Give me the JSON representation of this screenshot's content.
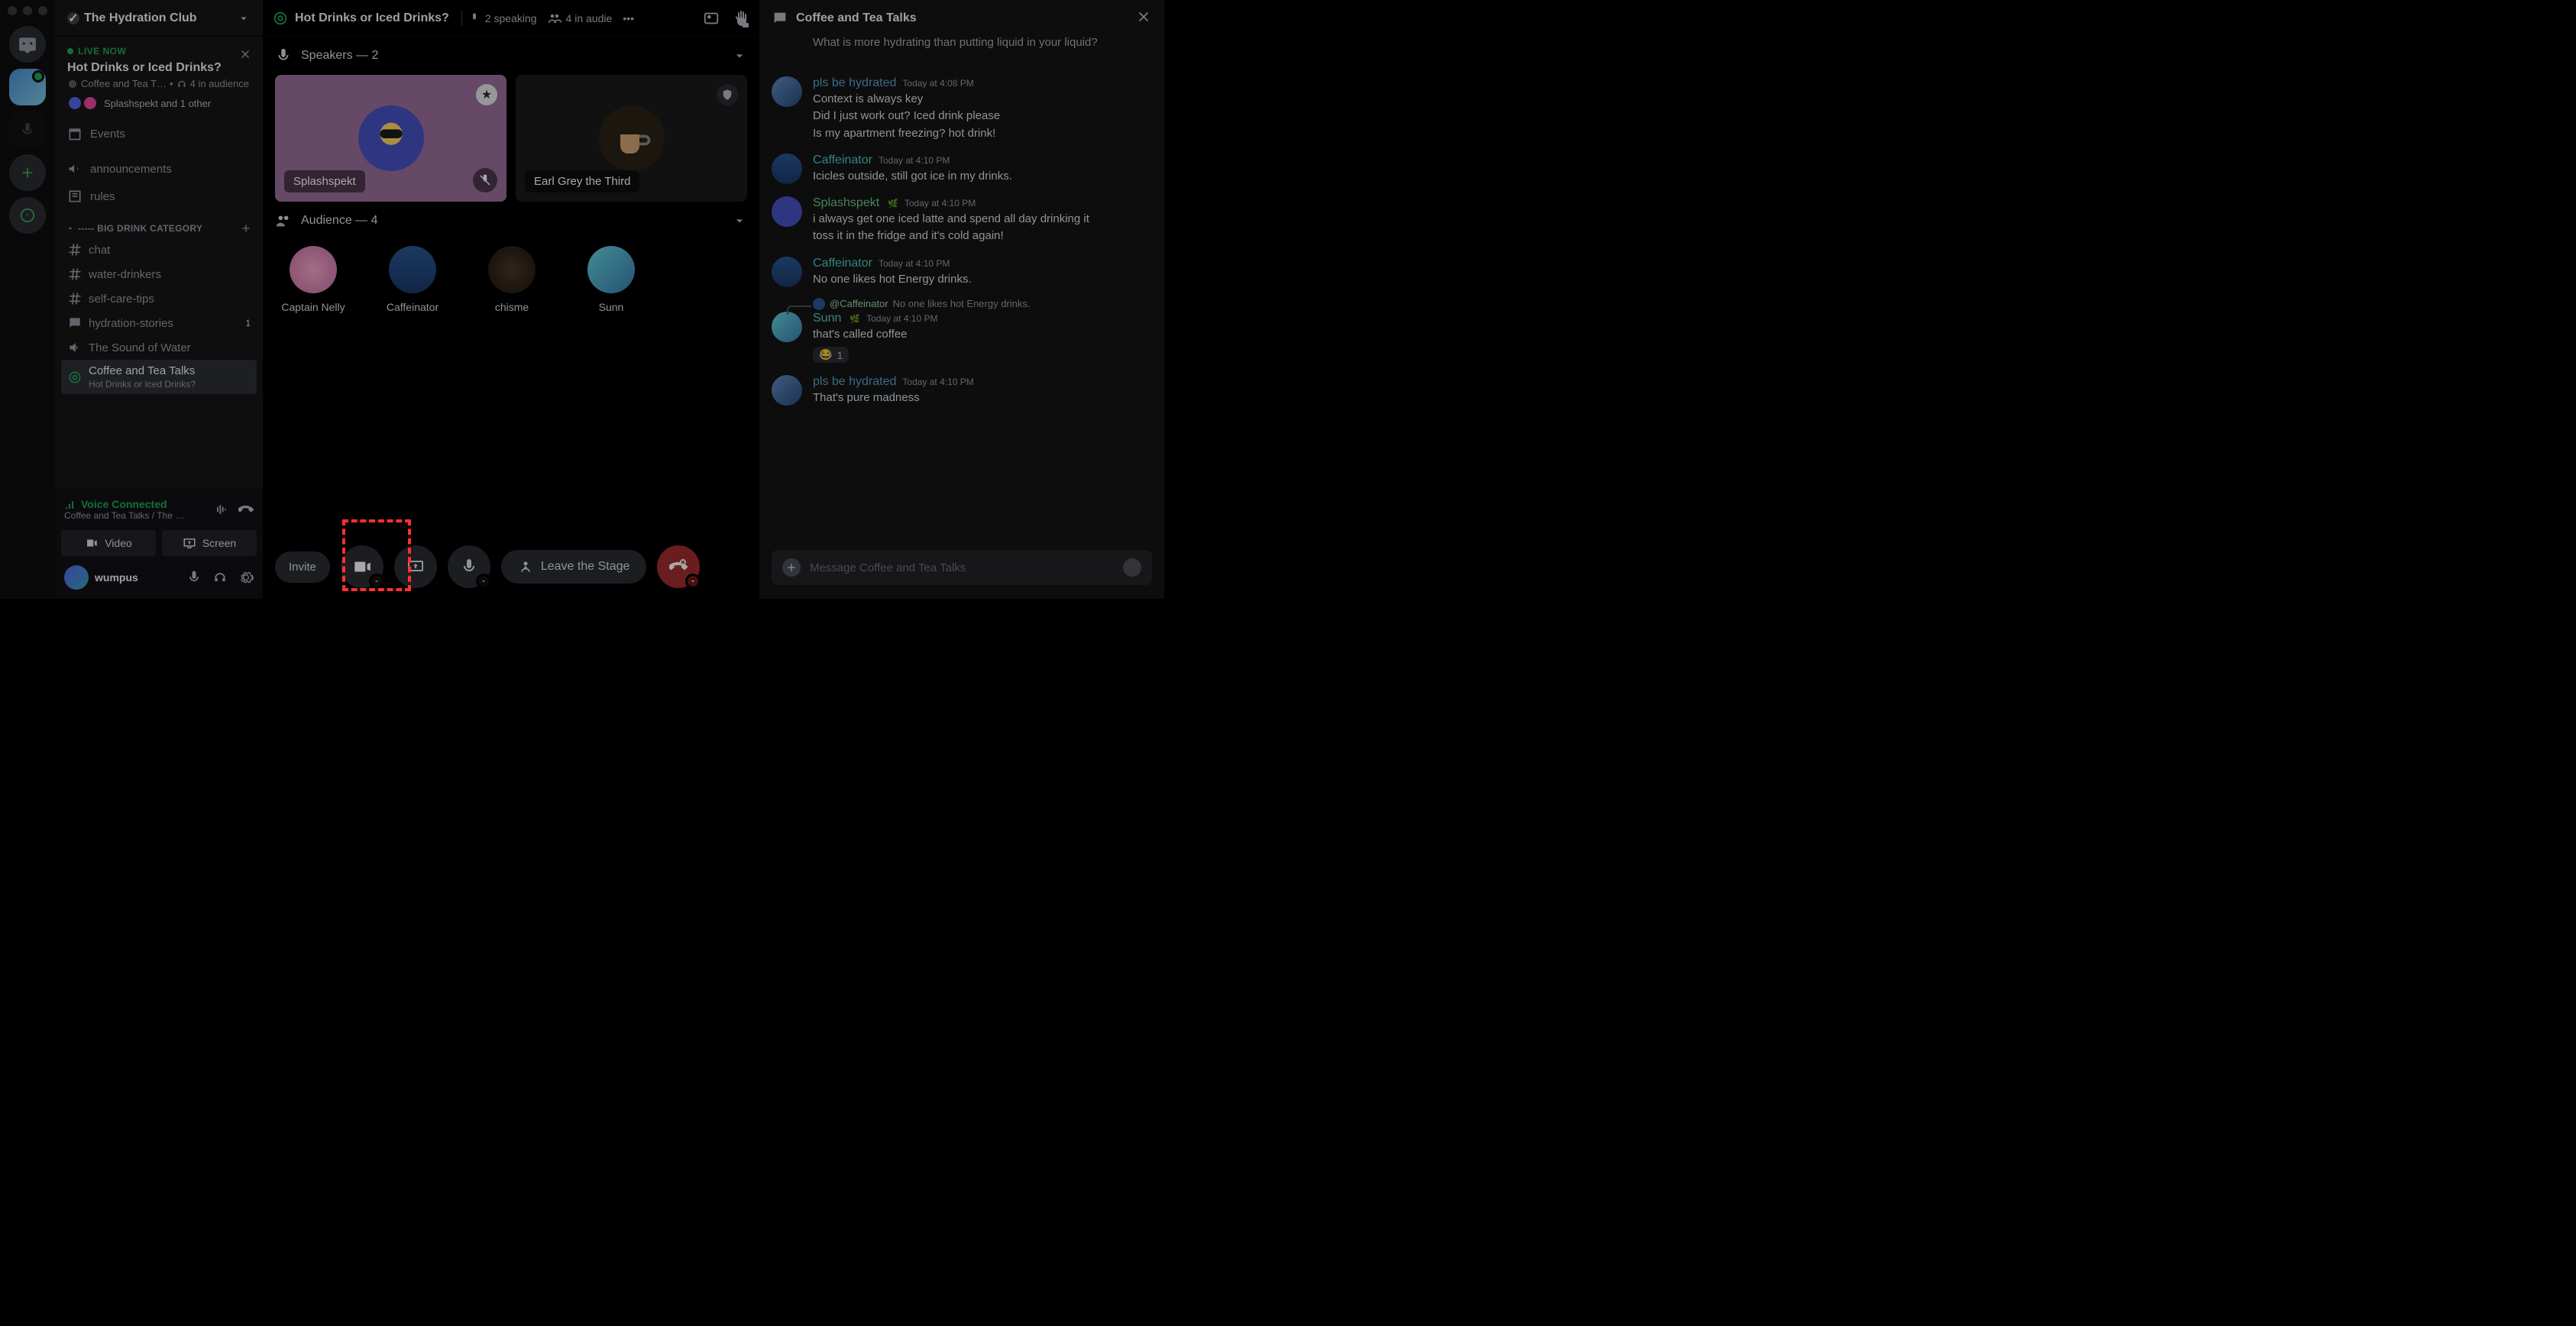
{
  "server": {
    "name": "The Hydration Club"
  },
  "liveCard": {
    "badge": "LIVE NOW",
    "title": "Hot Drinks or Iced Drinks?",
    "channel": "Coffee and Tea T…",
    "audience": "4 in audience",
    "people": "Splashspekt and 1 other"
  },
  "nav": {
    "events": "Events"
  },
  "channels": {
    "announcements": "announcements",
    "rules": "rules",
    "category": "----- BIG DRINK CATEGORY",
    "chat": "chat",
    "water": "water-drinkers",
    "selfcare": "self-care-tips",
    "stories": "hydration-stories",
    "storiesBadge": "1",
    "sound": "The Sound of Water",
    "coffee": "Coffee and Tea Talks",
    "coffeeSub": "Hot Drinks or Iced Drinks?"
  },
  "userPanel": {
    "connected": "Voice Connected",
    "location": "Coffee and Tea Talks / The …",
    "video": "Video",
    "screen": "Screen",
    "username": "wumpus"
  },
  "stage": {
    "title": "Hot Drinks or Iced Drinks?",
    "speaking": "2 speaking",
    "inAudience": "4 in audie",
    "speakersHeader": "Speakers — 2",
    "audienceHeader": "Audience — 4",
    "speakers": [
      {
        "name": "Splashspekt"
      },
      {
        "name": "Earl Grey the Third"
      }
    ],
    "audience": [
      {
        "name": "Captain Nelly"
      },
      {
        "name": "Caffeinator"
      },
      {
        "name": "chisme"
      },
      {
        "name": "Sunn"
      }
    ],
    "controls": {
      "invite": "Invite",
      "leave": "Leave the Stage"
    }
  },
  "chat": {
    "title": "Coffee and Tea Talks",
    "truncated": "What is more hydrating than putting liquid in your liquid?",
    "messages": {
      "m1_user": "pls be hydrated",
      "m1_time": "Today at 4:08 PM",
      "m1_t1": "Context is always key",
      "m1_t2": "Did I just work out? Iced drink please",
      "m1_t3": "Is my apartment freezing? hot drink!",
      "m2_user": "Caffeinator",
      "m2_time": "Today at 4:10 PM",
      "m2_t1": "Icicles outside, still got ice in my drinks.",
      "m3_user": "Splashspekt",
      "m3_time": "Today at 4:10 PM",
      "m3_t1": "i always get one iced latte and spend all day drinking it",
      "m3_t2": "toss it in the fridge and it's cold again!",
      "m4_user": "Caffeinator",
      "m4_time": "Today at 4:10 PM",
      "m4_t1": "No one likes hot Energy drinks.",
      "reply_user": "@Caffeinator",
      "reply_text": "No one likes hot Energy drinks.",
      "m5_user": "Sunn",
      "m5_time": "Today at 4:10 PM",
      "m5_t1": "that's called coffee",
      "m5_react": "1",
      "m6_user": "pls be hydrated",
      "m6_time": "Today at 4:10 PM",
      "m6_t1": "That's pure madness"
    },
    "placeholder": "Message Coffee and Tea Talks"
  }
}
